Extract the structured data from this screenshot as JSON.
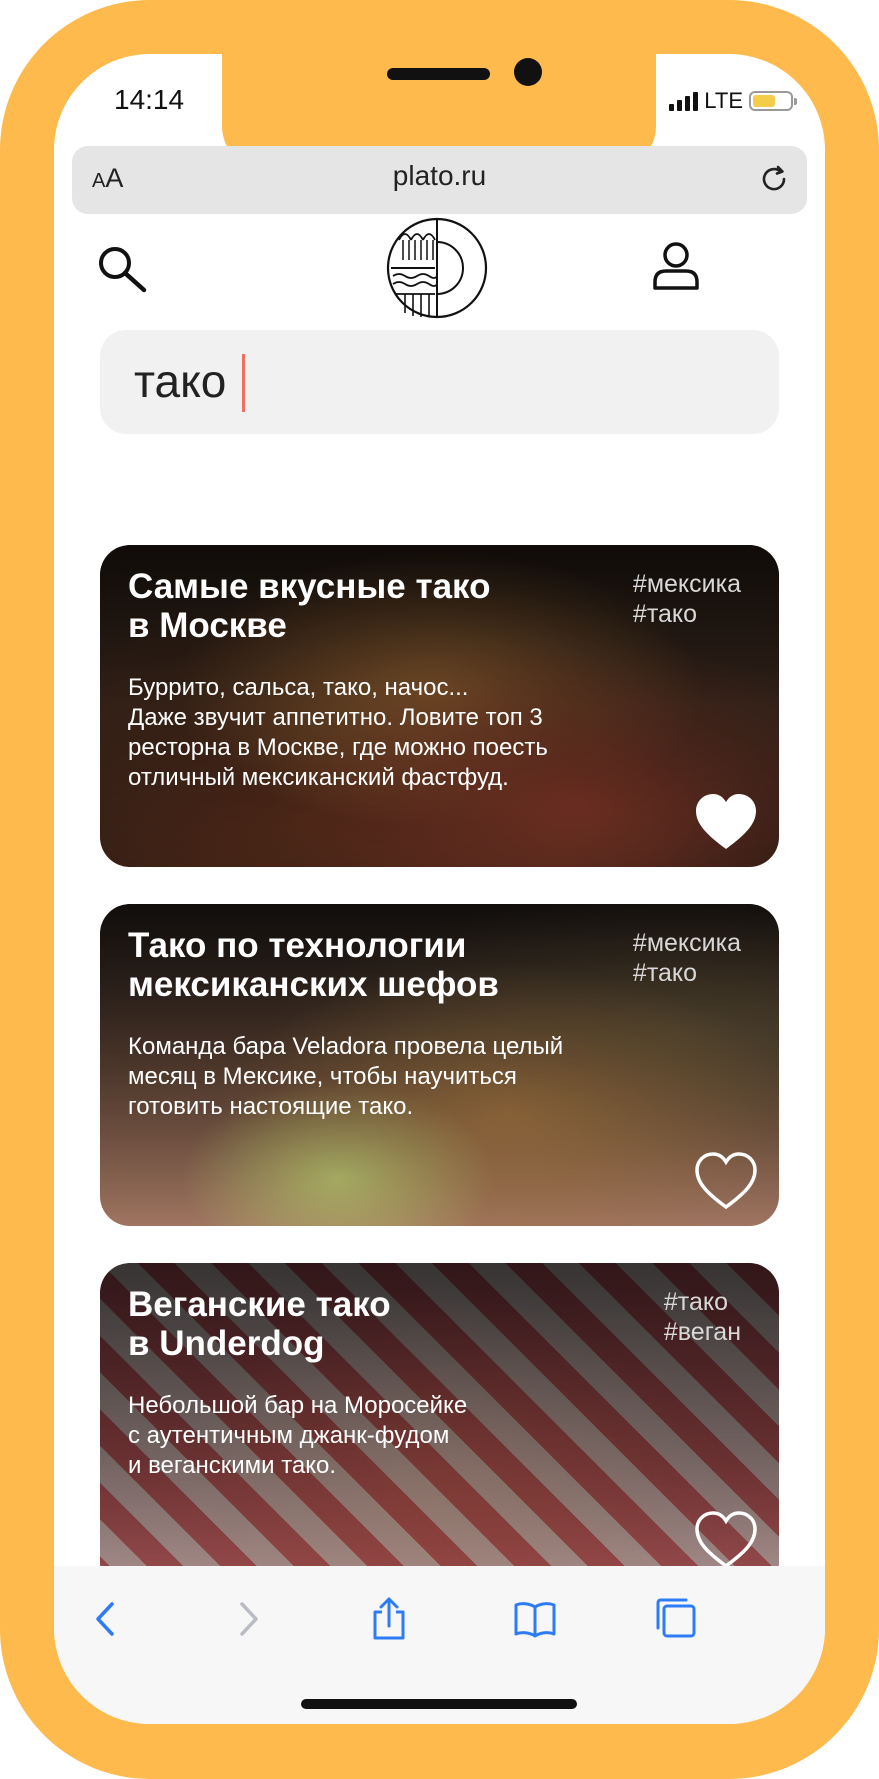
{
  "status_bar": {
    "time": "14:14",
    "network": "LTE"
  },
  "browser": {
    "text_size_small": "A",
    "text_size_big": "A",
    "url": "plato.ru"
  },
  "header": {
    "search_icon": "search-icon",
    "logo_icon": "plato-logo",
    "profile_icon": "profile-icon"
  },
  "search": {
    "value": "тако"
  },
  "cards": [
    {
      "title": "Самые вкусные тако\nв Москве",
      "tags": "#мексика\n#тако",
      "text": "Буррито, сальса, тако, начос...\nДаже звучит аппетитно. Ловите топ 3\nресторна в Москве, где можно поесть\nотличный мексиканский фастфуд.",
      "liked": true
    },
    {
      "title": "Тако по технологии\nмексиканских шефов",
      "tags": "#мексика\n#тако",
      "text": "Команда бара Veladora провела целый\nмесяц в Мексике, чтобы научиться\nготовить настоящие тако.",
      "liked": false
    },
    {
      "title": "Веганские тако\nв Underdog",
      "tags": "#тако\n#веган",
      "text": "Небольшой бар на Моросейке\nс аутентичным джанк-фудом\nи веганскими тако.",
      "liked": false
    }
  ],
  "toolbar": [
    "back-icon",
    "forward-icon",
    "share-icon",
    "bookmarks-icon",
    "tabs-icon"
  ],
  "colors": {
    "frame": "#FEBA4C",
    "accent": "#F0705F",
    "ios_blue": "#2D7CF6"
  }
}
